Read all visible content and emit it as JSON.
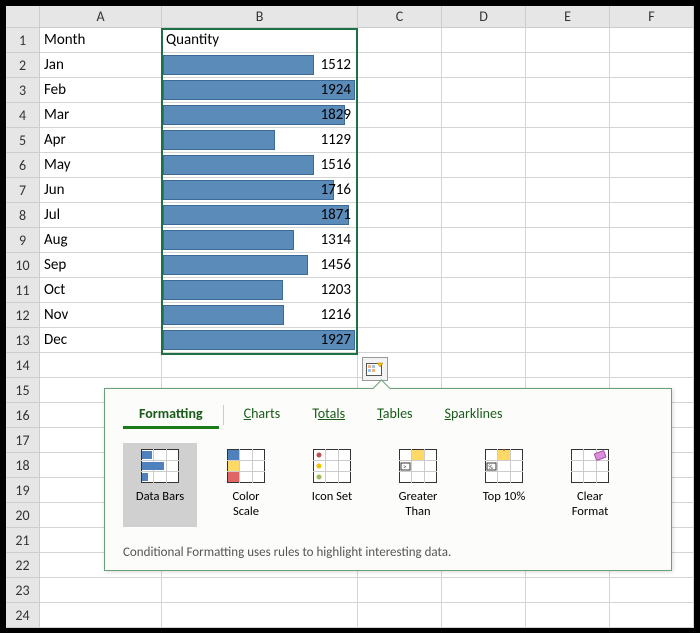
{
  "columns": [
    "A",
    "B",
    "C",
    "D",
    "E",
    "F"
  ],
  "headers": {
    "a": "Month",
    "b": "Quantity"
  },
  "chart_data": {
    "type": "bar",
    "title": "",
    "xlabel": "Month",
    "ylabel": "Quantity",
    "categories": [
      "Jan",
      "Feb",
      "Mar",
      "Apr",
      "May",
      "Jun",
      "Jul",
      "Aug",
      "Sep",
      "Oct",
      "Nov",
      "Dec"
    ],
    "values": [
      1512,
      1924,
      1829,
      1129,
      1516,
      1716,
      1871,
      1314,
      1456,
      1203,
      1216,
      1927
    ]
  },
  "qa_panel": {
    "tabs": {
      "formatting": "Formatting",
      "charts_pre": "C",
      "charts_rest": "harts",
      "totals_pre": "T",
      "totals_rest": "otals",
      "tables_pre": "T",
      "tables_rest": "ables",
      "sparklines_pre": "S",
      "sparklines_rest": "parklines"
    },
    "items": {
      "databars": "Data Bars",
      "colorscale_l1": "Color",
      "colorscale_l2": "Scale",
      "iconset": "Icon Set",
      "greater_l1": "Greater",
      "greater_l2": "Than",
      "top10": "Top 10%",
      "clear_l1": "Clear",
      "clear_l2": "Format"
    },
    "description": "Conditional Formatting uses rules to highlight interesting data."
  }
}
